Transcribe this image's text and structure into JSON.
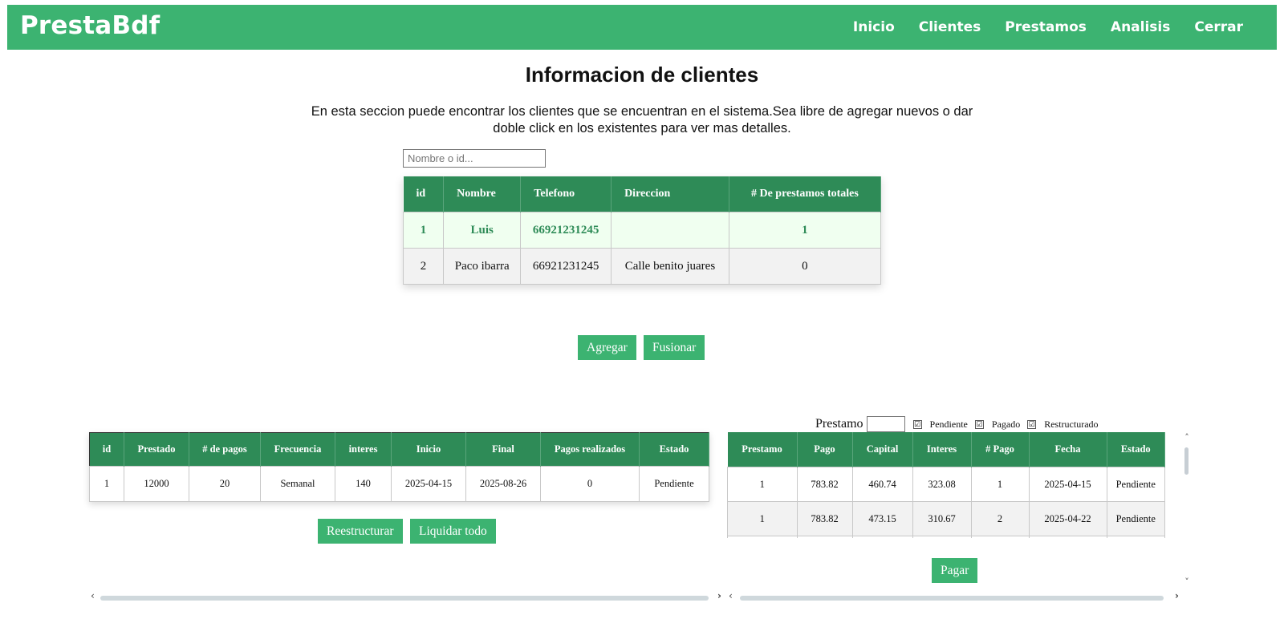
{
  "navbar": {
    "brand": "PrestaBdf",
    "links": [
      "Inicio",
      "Clientes",
      "Prestamos",
      "Analisis",
      "Cerrar"
    ]
  },
  "page": {
    "title": "Informacion de clientes",
    "description": "En esta seccion puede encontrar los clientes que se encuentran en el sistema.Sea libre de agregar nuevos o dar doble click en los existentes para ver mas detalles."
  },
  "search": {
    "placeholder": "Nombre o id...",
    "value": ""
  },
  "clients": {
    "columns": [
      "id",
      "Nombre",
      "Telefono",
      "Direccion",
      "# De prestamos totales"
    ],
    "rows": [
      [
        "1",
        "Luis",
        "66921231245",
        "",
        "1"
      ],
      [
        "2",
        "Paco ibarra",
        "66921231245",
        "Calle benito juares",
        "0"
      ]
    ]
  },
  "client_actions": {
    "add": "Agregar",
    "merge": "Fusionar"
  },
  "loans": {
    "columns": [
      "id",
      "Prestado",
      "# de pagos",
      "Frecuencia",
      "interes",
      "Inicio",
      "Final",
      "Pagos realizados",
      "Estado"
    ],
    "rows": [
      [
        "1",
        "12000",
        "20",
        "Semanal",
        "140",
        "2025-04-15",
        "2025-08-26",
        "0",
        "Pendiente"
      ]
    ]
  },
  "loan_actions": {
    "restructure": "Reestructurar",
    "settle": "Liquidar todo"
  },
  "payment_filter": {
    "label": "Prestamo",
    "loan_value": "",
    "options": [
      {
        "label": "Pendiente",
        "checked": true
      },
      {
        "label": "Pagado",
        "checked": true
      },
      {
        "label": "Restructurado",
        "checked": true
      }
    ]
  },
  "payments": {
    "columns": [
      "Prestamo",
      "Pago",
      "Capital",
      "Interes",
      "# Pago",
      "Fecha",
      "Estado"
    ],
    "rows": [
      [
        "1",
        "783.82",
        "460.74",
        "323.08",
        "1",
        "2025-04-15",
        "Pendiente"
      ],
      [
        "1",
        "783.82",
        "473.15",
        "310.67",
        "2",
        "2025-04-22",
        "Pendiente"
      ],
      [
        "",
        "",
        "",
        "",
        "",
        "",
        ""
      ]
    ]
  },
  "payment_actions": {
    "pay": "Pagar"
  },
  "icons": {
    "check": "check-icon",
    "scroll_up": "chevron-up-icon",
    "scroll_down": "chevron-down-icon",
    "scroll_left": "chevron-left-icon",
    "scroll_right": "chevron-right-icon"
  },
  "colors": {
    "primary": "#3cb371",
    "header_dark": "#2e8b57",
    "active_row": "#f0fff0",
    "alt_row": "#f2f2f2"
  }
}
